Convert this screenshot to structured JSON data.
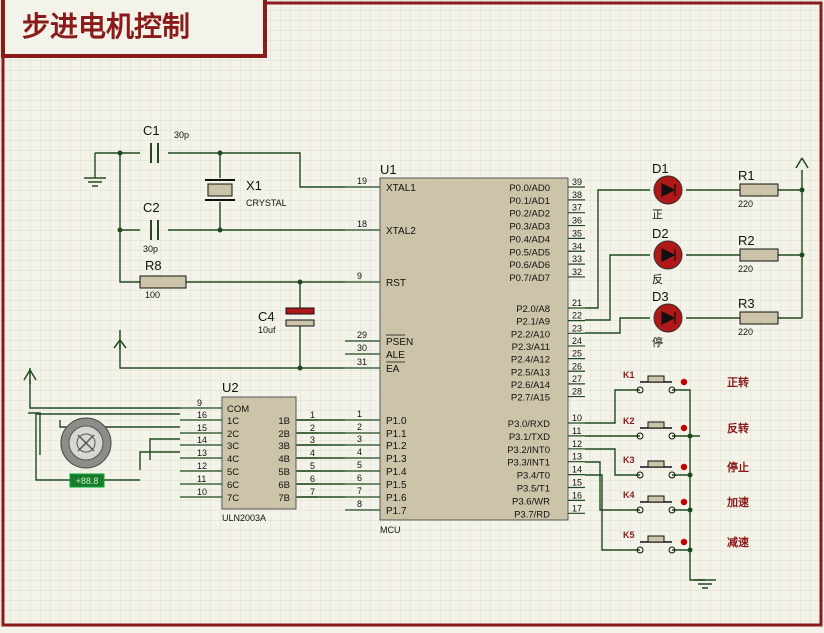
{
  "title": "步进电机控制",
  "colors": {
    "wire": "#1f4a1f",
    "frame": "#8b1a1a",
    "chip": "#cbc4a8",
    "led": "#b01818",
    "sw_dot": "#c00000"
  },
  "mcu": {
    "ref": "U1",
    "label": "MCU",
    "left_pins": [
      {
        "num": "19",
        "name": "XTAL1"
      },
      {
        "num": "18",
        "name": "XTAL2"
      },
      {
        "num": "9",
        "name": "RST"
      },
      {
        "num": "29",
        "name": "PSEN"
      },
      {
        "num": "30",
        "name": "ALE"
      },
      {
        "num": "31",
        "name": "EA"
      },
      {
        "num": "1",
        "name": "P1.0"
      },
      {
        "num": "2",
        "name": "P1.1"
      },
      {
        "num": "3",
        "name": "P1.2"
      },
      {
        "num": "4",
        "name": "P1.3"
      },
      {
        "num": "5",
        "name": "P1.4"
      },
      {
        "num": "6",
        "name": "P1.5"
      },
      {
        "num": "7",
        "name": "P1.6"
      },
      {
        "num": "8",
        "name": "P1.7"
      }
    ],
    "right_pins": [
      {
        "num": "39",
        "name": "P0.0/AD0"
      },
      {
        "num": "38",
        "name": "P0.1/AD1"
      },
      {
        "num": "37",
        "name": "P0.2/AD2"
      },
      {
        "num": "36",
        "name": "P0.3/AD3"
      },
      {
        "num": "35",
        "name": "P0.4/AD4"
      },
      {
        "num": "34",
        "name": "P0.5/AD5"
      },
      {
        "num": "33",
        "name": "P0.6/AD6"
      },
      {
        "num": "32",
        "name": "P0.7/AD7"
      },
      {
        "num": "21",
        "name": "P2.0/A8"
      },
      {
        "num": "22",
        "name": "P2.1/A9"
      },
      {
        "num": "23",
        "name": "P2.2/A10"
      },
      {
        "num": "24",
        "name": "P2.3/A11"
      },
      {
        "num": "25",
        "name": "P2.4/A12"
      },
      {
        "num": "26",
        "name": "P2.5/A13"
      },
      {
        "num": "27",
        "name": "P2.6/A14"
      },
      {
        "num": "28",
        "name": "P2.7/A15"
      },
      {
        "num": "10",
        "name": "P3.0/RXD"
      },
      {
        "num": "11",
        "name": "P3.1/TXD"
      },
      {
        "num": "12",
        "name": "P3.2/INT0"
      },
      {
        "num": "13",
        "name": "P3.3/INT1"
      },
      {
        "num": "14",
        "name": "P3.4/T0"
      },
      {
        "num": "15",
        "name": "P3.5/T1"
      },
      {
        "num": "16",
        "name": "P3.6/WR"
      },
      {
        "num": "17",
        "name": "P3.7/RD"
      }
    ]
  },
  "uln": {
    "ref": "U2",
    "label": "ULN2003A",
    "left_pins": [
      {
        "num": "9",
        "name": "COM"
      },
      {
        "num": "16",
        "name": "1C"
      },
      {
        "num": "15",
        "name": "2C"
      },
      {
        "num": "14",
        "name": "3C"
      },
      {
        "num": "13",
        "name": "4C"
      },
      {
        "num": "12",
        "name": "5C"
      },
      {
        "num": "11",
        "name": "6C"
      },
      {
        "num": "10",
        "name": "7C"
      }
    ],
    "right_pins": [
      {
        "num": "1",
        "name": "1B"
      },
      {
        "num": "2",
        "name": "2B"
      },
      {
        "num": "3",
        "name": "3B"
      },
      {
        "num": "4",
        "name": "4B"
      },
      {
        "num": "5",
        "name": "5B"
      },
      {
        "num": "6",
        "name": "6B"
      },
      {
        "num": "7",
        "name": "7B"
      }
    ]
  },
  "parts": {
    "c1": {
      "ref": "C1",
      "value": "30p"
    },
    "c2": {
      "ref": "C2",
      "value": "30p"
    },
    "x1": {
      "ref": "X1",
      "value": "CRYSTAL"
    },
    "r8": {
      "ref": "R8",
      "value": "100"
    },
    "c4": {
      "ref": "C4",
      "value": "10uf"
    }
  },
  "leds": [
    {
      "ref": "D1",
      "text": "正",
      "res_ref": "R1",
      "res_value": "220"
    },
    {
      "ref": "D2",
      "text": "反",
      "res_ref": "R2",
      "res_value": "220"
    },
    {
      "ref": "D3",
      "text": "停",
      "res_ref": "R3",
      "res_value": "220"
    }
  ],
  "switches": [
    {
      "ref": "K1",
      "text": "正转"
    },
    {
      "ref": "K2",
      "text": "反转"
    },
    {
      "ref": "K3",
      "text": "停止"
    },
    {
      "ref": "K4",
      "text": "加速"
    },
    {
      "ref": "K5",
      "text": "减速"
    }
  ],
  "motor": {
    "readout": "+88.8"
  }
}
